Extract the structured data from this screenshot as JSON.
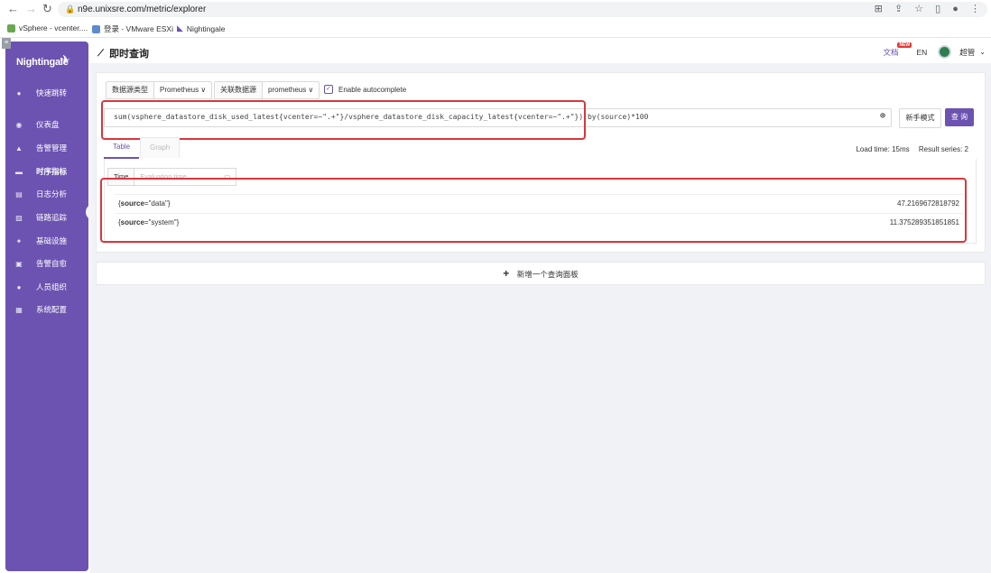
{
  "browser": {
    "url": "n9e.unixsre.com/metric/explorer",
    "bookmarks": [
      {
        "label": "vSphere - vcenter....",
        "color": "#6aa84f"
      },
      {
        "label": "登录 - VMware ESXi",
        "color": "#5b8ccf"
      },
      {
        "label": "Nightingale",
        "color": "#6c53b1"
      }
    ]
  },
  "sidebar": {
    "logo": "Nightingale",
    "items": [
      {
        "label": "快速跳转",
        "icon": "search-icon",
        "glyph": "●"
      },
      {
        "label": "仪表盘",
        "icon": "dashboard-icon",
        "glyph": "◉"
      },
      {
        "label": "告警管理",
        "icon": "alarm-icon",
        "glyph": "▲"
      },
      {
        "label": "时序指标",
        "icon": "metrics-icon",
        "glyph": "▬"
      },
      {
        "label": "日志分析",
        "icon": "log-icon",
        "glyph": "▤"
      },
      {
        "label": "链路追踪",
        "icon": "trace-icon",
        "glyph": "▨"
      },
      {
        "label": "基础设施",
        "icon": "infra-icon",
        "glyph": "✦"
      },
      {
        "label": "告警自愈",
        "icon": "heal-icon",
        "glyph": "▣"
      },
      {
        "label": "人员组织",
        "icon": "user-icon",
        "glyph": "●"
      },
      {
        "label": "系统配置",
        "icon": "settings-icon",
        "glyph": "▦"
      }
    ]
  },
  "header": {
    "title": "即时查询",
    "docs_label": "文档",
    "new_badge": "NEW",
    "lang": "EN",
    "user": "超管"
  },
  "query": {
    "datasource_type_label": "数据源类型",
    "datasource_type_value": "Prometheus",
    "datasource_label": "关联数据源",
    "datasource_value": "prometheus",
    "autocomplete_label": "Enable autocomplete",
    "expression": "sum(vsphere_datastore_disk_used_latest{vcenter=~\".+\"}/vsphere_datastore_disk_capacity_latest{vcenter=~\".+\"}) by(source)*100",
    "novice_mode_label": "新手模式",
    "query_button": "查 询"
  },
  "results": {
    "tabs": [
      "Table",
      "Graph"
    ],
    "load_time": "Load time: 15ms",
    "result_series": "Result series: 2",
    "time_label": "Time",
    "time_placeholder": "Evaluation time",
    "rows": [
      {
        "key_name": "source",
        "key_value": "\"data\"",
        "value": "47.2169672818792"
      },
      {
        "key_name": "source",
        "key_value": "\"system\"",
        "value": "11.375289351851851"
      }
    ]
  },
  "add_panel_label": "新增一个查询面板"
}
